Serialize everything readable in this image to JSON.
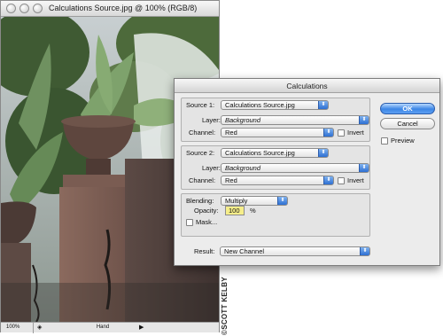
{
  "document_window": {
    "title": "Calculations Source.jpg @ 100% (RGB/8)",
    "status": {
      "zoom": "100%",
      "tool": "Hand"
    }
  },
  "credit": "©SCOTT KELBY",
  "dialog": {
    "title": "Calculations",
    "source1": {
      "label": "Source 1:",
      "file": "Calculations Source.jpg",
      "layer_label": "Layer:",
      "layer": "Background",
      "channel_label": "Channel:",
      "channel": "Red",
      "invert_label": "Invert",
      "invert_checked": false
    },
    "source2": {
      "label": "Source 2:",
      "file": "Calculations Source.jpg",
      "layer_label": "Layer:",
      "layer": "Background",
      "channel_label": "Channel:",
      "channel": "Red",
      "invert_label": "Invert",
      "invert_checked": false
    },
    "blending": {
      "label": "Blending:",
      "mode": "Multiply",
      "opacity_label": "Opacity:",
      "opacity": "100",
      "opacity_unit": "%",
      "mask_label": "Mask...",
      "mask_checked": false
    },
    "result": {
      "label": "Result:",
      "value": "New Channel"
    },
    "buttons": {
      "ok": "OK",
      "cancel": "Cancel"
    },
    "preview": {
      "label": "Preview",
      "checked": false
    }
  },
  "colors": {
    "accent_blue": "#3c86e6",
    "opacity_highlight": "#f6ee8a"
  }
}
